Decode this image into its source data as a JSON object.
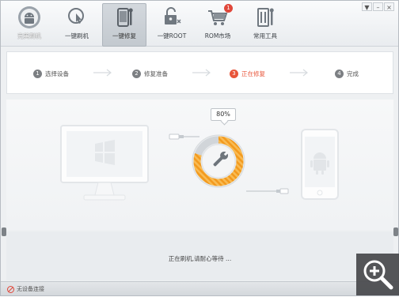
{
  "toolbar": {
    "items": [
      {
        "label": "完美刷机",
        "icon": "android-icon"
      },
      {
        "label": "一键刷机",
        "icon": "touch-icon"
      },
      {
        "label": "一键修复",
        "icon": "repair-phone-icon"
      },
      {
        "label": "一键ROOT",
        "icon": "unlock-icon"
      },
      {
        "label": "ROM市场",
        "icon": "cart-icon",
        "badge": "1"
      },
      {
        "label": "常用工具",
        "icon": "tools-icon"
      }
    ],
    "active_index": 2
  },
  "window_controls": {
    "menu": "▼",
    "minimize": "–",
    "close": "×"
  },
  "steps": [
    {
      "number": "1",
      "label": "选择设备"
    },
    {
      "number": "2",
      "label": "修复准备"
    },
    {
      "number": "3",
      "label": "正在修复"
    },
    {
      "number": "4",
      "label": "完成"
    }
  ],
  "current_step_index": 2,
  "progress": {
    "percent_label": "80%",
    "value": 0.8
  },
  "status_message": "正在刷机,请耐心等待 ...",
  "footer": {
    "device_status": "无设备连接"
  },
  "colors": {
    "accent": "#e8553a",
    "progress_orange": "#f39a1e",
    "ring_gray": "#cfd3d7"
  }
}
